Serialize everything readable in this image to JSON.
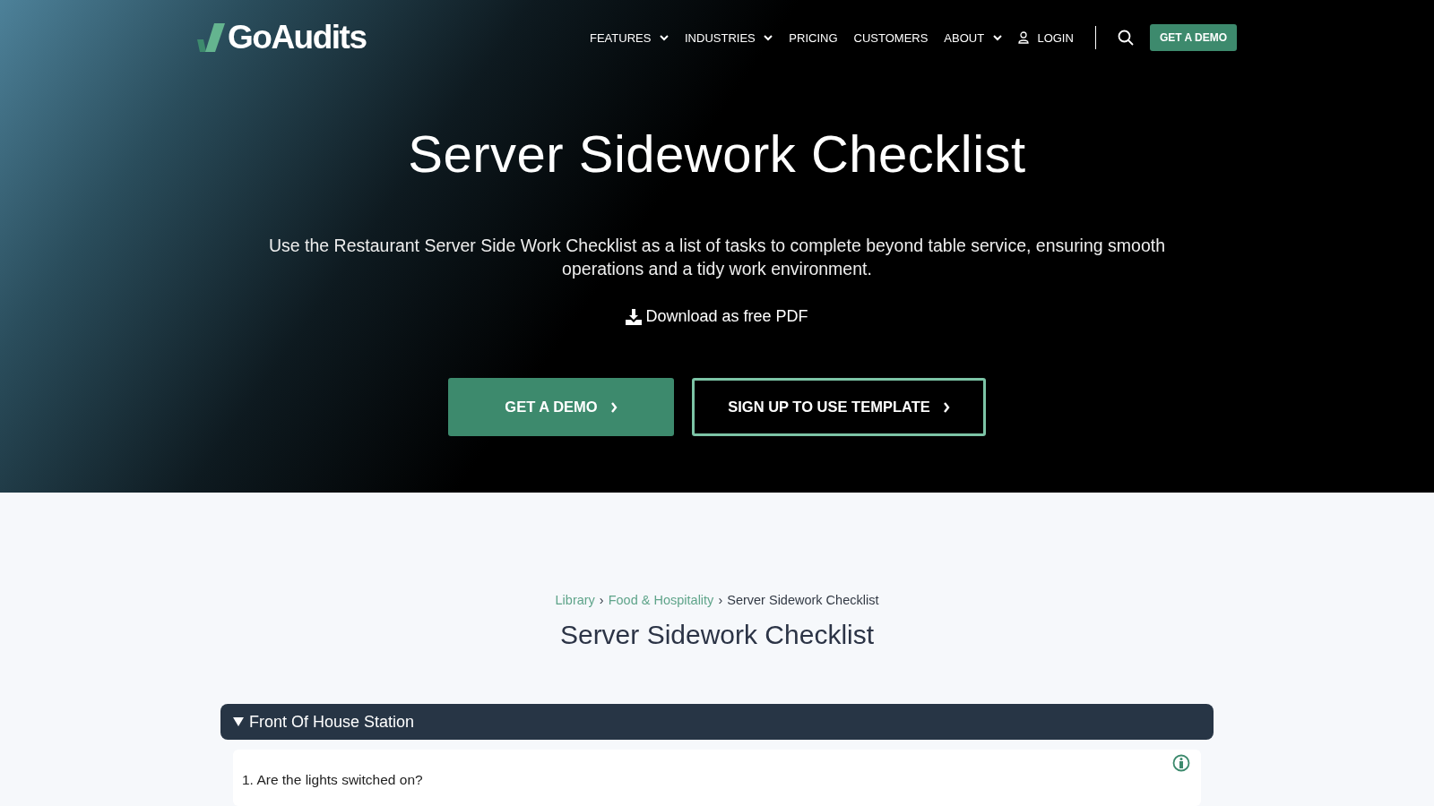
{
  "logo": {
    "text": "GoAudits"
  },
  "nav": {
    "items": [
      {
        "label": "FEATURES",
        "dropdown": true
      },
      {
        "label": "INDUSTRIES",
        "dropdown": true
      },
      {
        "label": "PRICING",
        "dropdown": false
      },
      {
        "label": "CUSTOMERS",
        "dropdown": false
      },
      {
        "label": "ABOUT",
        "dropdown": true
      }
    ],
    "login": "LOGIN",
    "cta": "GET A DEMO"
  },
  "hero": {
    "title": "Server Sidework Checklist",
    "subtitle": "Use the Restaurant Server Side Work Checklist as a list of tasks to complete beyond table service, ensuring smooth operations and a tidy work environment.",
    "download": "Download as free PDF",
    "buttons": [
      {
        "label": "GET A DEMO",
        "kind": "filled"
      },
      {
        "label": "SIGN UP TO USE TEMPLATE",
        "kind": "outline"
      }
    ]
  },
  "breadcrumb": [
    {
      "label": "Library",
      "link": true
    },
    {
      "label": "Food & Hospitality",
      "link": true
    },
    {
      "label": "Server Sidework Checklist",
      "link": false
    }
  ],
  "separator": "›",
  "page_title": "Server Sidework Checklist",
  "sections": [
    {
      "title": "Front Of House Station",
      "expanded": true,
      "questions": [
        "1. Are the lights switched on?"
      ]
    }
  ]
}
